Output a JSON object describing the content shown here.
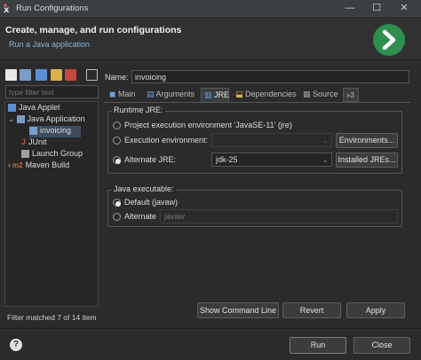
{
  "window": {
    "title": "Run Configurations",
    "minimize_glyph": "—",
    "maximize_glyph": "☐",
    "close_glyph": "✕"
  },
  "header": {
    "title": "Create, manage, and run configurations",
    "subtitle": "Run a Java application"
  },
  "sidebar": {
    "filter_placeholder": "type filter text",
    "items": [
      {
        "label": "Java Applet"
      },
      {
        "label": "Java Application"
      },
      {
        "label": "invoicing"
      },
      {
        "label": "JUnit"
      },
      {
        "label": "Launch Group"
      },
      {
        "label": "Maven Build"
      }
    ],
    "status": "Filter matched 7 of 14 item"
  },
  "name_field": {
    "label": "Name:",
    "value": "invoicing"
  },
  "tabs": [
    {
      "label": "Main"
    },
    {
      "label": "Arguments"
    },
    {
      "label": "JRE"
    },
    {
      "label": "Dependencies"
    },
    {
      "label": "Source"
    },
    {
      "label": "»3"
    }
  ],
  "runtime_jre": {
    "group_label": "Runtime JRE:",
    "project_env_label": "Project execution environment 'JavaSE-11' (jre)",
    "exec_env_label": "Execution environment:",
    "environments_button": "Environments...",
    "alternate_label": "Alternate JRE:",
    "alternate_value": "jdk-25",
    "installed_button": "Installed JREs..."
  },
  "java_executable": {
    "group_label": "Java executable:",
    "default_label": "Default (javaw)",
    "alternate_label": "Alternate",
    "alternate_value": "javaw"
  },
  "buttons": {
    "show_command_line": "Show Command Line",
    "revert": "Revert",
    "apply": "Apply",
    "run": "Run",
    "close": "Close",
    "help": "?"
  },
  "colors": {
    "run_green": "#2f8f4e",
    "selection": "#3d4c5f",
    "toolbar_red": "#c8473c"
  }
}
